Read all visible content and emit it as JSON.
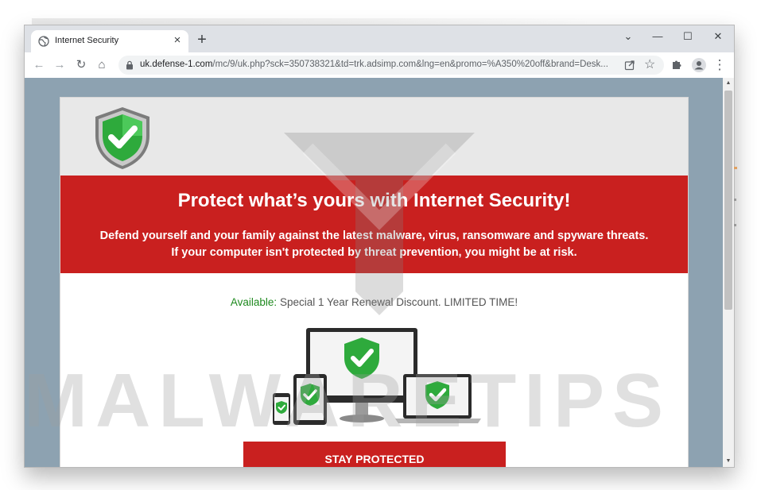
{
  "browser": {
    "tab": {
      "title": "Internet Security",
      "close_glyph": "×",
      "favicon_icon": "globe-icon"
    },
    "new_tab_glyph": "+",
    "window_controls": {
      "tab_search_glyph": "⌄",
      "minimize_glyph": "—",
      "maximize_glyph": "☐",
      "close_glyph": "✕"
    },
    "toolbar": {
      "back_glyph": "←",
      "forward_glyph": "→",
      "reload_glyph": "↻",
      "home_glyph": "⌂",
      "share_icon": "share-icon",
      "bookmark_glyph": "☆",
      "extensions_icon": "puzzle-icon",
      "profile_icon": "account-icon",
      "menu_glyph": "⋮"
    },
    "url": {
      "host": "uk.defense-1.com",
      "path": "/mc/9/uk.php?sck=350738321&td=trk.adsimp.com&lng=en&promo=%A350%20off&brand=Desk..."
    }
  },
  "page": {
    "logo_icon": "green-check-shield-icon",
    "headline": "Protect what’s yours with Internet Security!",
    "sub_line1": "Defend yourself and your family against the latest malware, virus, ransomware and spyware threats.",
    "sub_line2": "If your computer isn't protected by threat prevention, you might be at risk.",
    "available_label": "Available:",
    "available_text": "Special 1 Year Renewal Discount. LIMITED TIME!",
    "devices_icon": "protected-devices-illustration",
    "cta_label": "STAY PROTECTED"
  },
  "overlay": {
    "watermark": "MALWARETIPS"
  },
  "colors": {
    "banner_red": "#c9201f",
    "available_green": "#1f8a1f",
    "viewport_bg": "#8da2b1",
    "shield_green": "#2eaa3c"
  }
}
